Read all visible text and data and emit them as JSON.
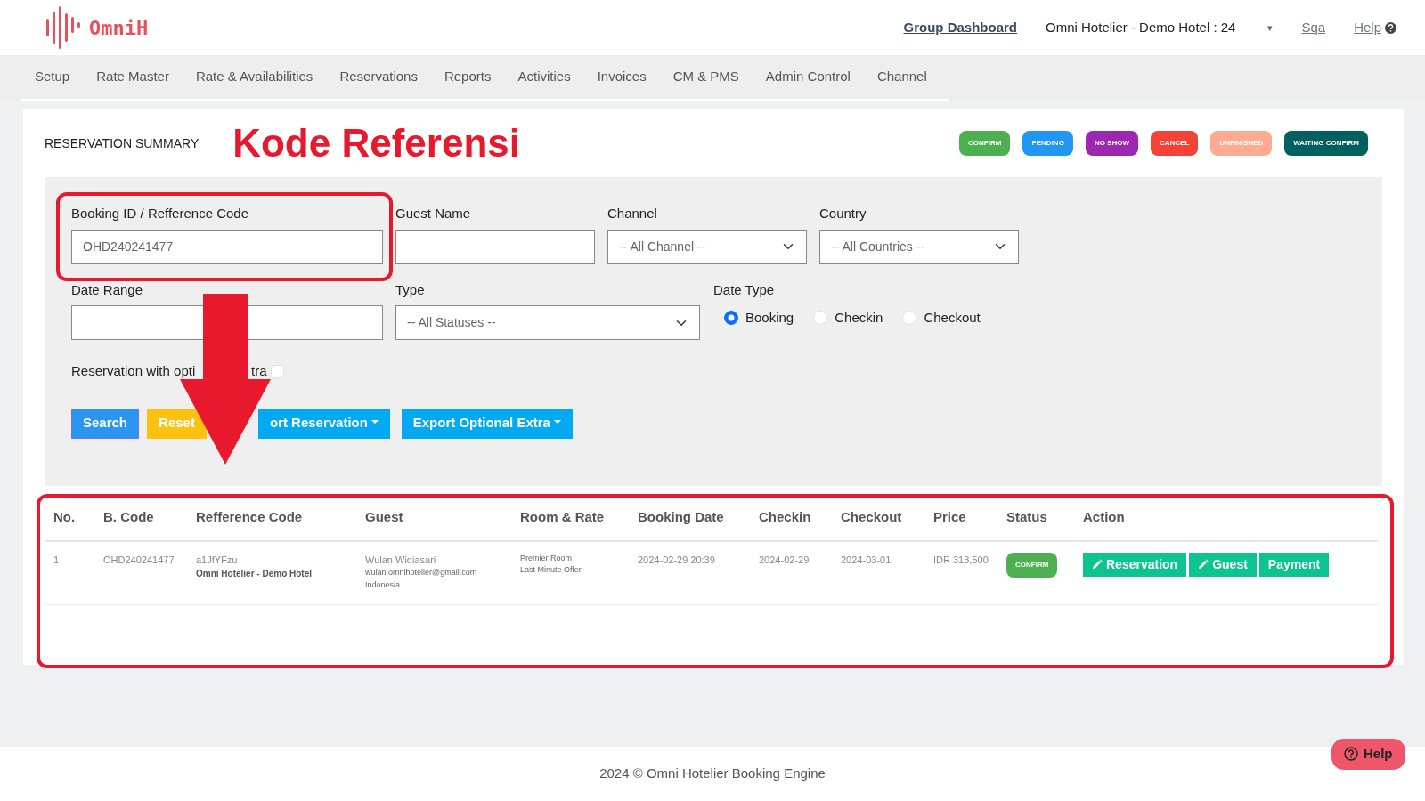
{
  "navbar": {
    "brand": "OmniH",
    "group_dashboard": "Group Dashboard",
    "hotel": "Omni Hotelier - Demo Hotel : 24",
    "hotel_caret": "▾",
    "user": "Sqa",
    "help": "Help"
  },
  "menu": [
    {
      "label": "Setup"
    },
    {
      "label": "Rate Master"
    },
    {
      "label": "Rate & Availabilities"
    },
    {
      "label": "Reservations"
    },
    {
      "label": "Reports"
    },
    {
      "label": "Activities"
    },
    {
      "label": "Invoices"
    },
    {
      "label": "CM & PMS"
    },
    {
      "label": "Admin Control"
    },
    {
      "label": "Channel"
    }
  ],
  "summary": {
    "title": "RESERVATION SUMMARY",
    "annotation": "Kode Referensi",
    "legend": [
      {
        "label": "CONFIRM",
        "color": "#4caf50"
      },
      {
        "label": "PENDING",
        "color": "#2196f3"
      },
      {
        "label": "NO SHOW",
        "color": "#9c27b0"
      },
      {
        "label": "CANCEL",
        "color": "#f44336"
      },
      {
        "label": "UNFINISHED",
        "color": "#ffab91"
      },
      {
        "label": "WAITING CONFIRM",
        "color": "#005f5f"
      }
    ]
  },
  "filters": {
    "booking": {
      "label": "Booking ID / Refference Code",
      "value": "OHD240241477"
    },
    "guest_name": {
      "label": "Guest Name"
    },
    "channel": {
      "label": "Channel",
      "value": "-- All Channel --"
    },
    "country": {
      "label": "Country",
      "value": "-- All Countries --"
    },
    "date_range": {
      "label": "Date Range"
    },
    "type": {
      "label": "Type",
      "value": "-- All Statuses --"
    },
    "date_type": {
      "label": "Date Type",
      "options": [
        {
          "label": "Booking",
          "selected": true
        },
        {
          "label": "Checkin",
          "selected": false
        },
        {
          "label": "Checkout",
          "selected": false
        }
      ]
    },
    "optional_extra": {
      "label_start": "Reservation with opti",
      "label_end": "tra",
      "checked": false
    },
    "buttons": [
      {
        "label": "Search",
        "kind": "primary",
        "dropdown": false
      },
      {
        "label": "Reset",
        "kind": "warning",
        "dropdown": false
      },
      {
        "label": "ort Reservation",
        "kind": "export",
        "dropdown": true
      },
      {
        "label": "Export Optional Extra",
        "kind": "export",
        "dropdown": true
      }
    ]
  },
  "table": {
    "columns": [
      "No.",
      "B. Code",
      "Refference Code",
      "Guest",
      "Room & Rate",
      "Booking Date",
      "Checkin",
      "Checkout",
      "Price",
      "Status",
      "Action"
    ],
    "rows": [
      {
        "no": "1",
        "b_code": "OHD240241477",
        "reference": {
          "code": "a1JfYFzu",
          "hotel": "Omni Hotelier - Demo Hotel"
        },
        "guest": {
          "name": "Wulan Widiasari",
          "email": "wulan.omnihotelier@gmail.com",
          "country": "Indonesia"
        },
        "room": {
          "room": "Premier Room",
          "rate": "Last Minute Offer"
        },
        "booking_date": "2024-02-29 20:39",
        "checkin": "2024-02-29",
        "checkout": "2024-03-01",
        "price": "IDR 313,500",
        "status": {
          "label": "CONFIRM",
          "color": "#4caf50"
        },
        "actions": [
          {
            "label": "Reservation",
            "kind": "edit"
          },
          {
            "label": "Guest",
            "kind": "edit"
          },
          {
            "label": "Payment",
            "kind": "plain"
          }
        ]
      }
    ]
  },
  "footer": {
    "text": "2024 © Omni Hotelier Booking Engine",
    "help_button": "Help"
  }
}
